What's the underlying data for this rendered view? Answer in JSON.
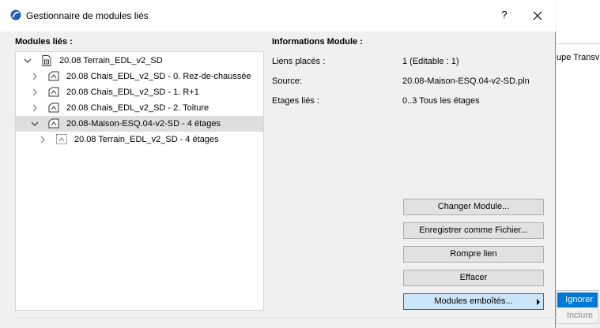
{
  "window": {
    "title": "Gestionnaire de modules liés",
    "help_label": "?"
  },
  "left_label": "Modules liés :",
  "right_label": "Informations Module :",
  "tree": [
    {
      "label": "20.08 Terrain_EDL_v2_SD",
      "level": 0,
      "expanded": true,
      "selected": false,
      "icon": "module-file-icon"
    },
    {
      "label": "20.08 Chais_EDL_v2_SD - 0. Rez-de-chaussée",
      "level": 1,
      "expanded": false,
      "selected": false,
      "icon": "linked-module-icon"
    },
    {
      "label": "20.08 Chais_EDL_v2_SD - 1. R+1",
      "level": 1,
      "expanded": false,
      "selected": false,
      "icon": "linked-module-icon"
    },
    {
      "label": "20.08 Chais_EDL_v2_SD - 2. Toiture",
      "level": 1,
      "expanded": false,
      "selected": false,
      "icon": "linked-module-icon"
    },
    {
      "label": "20.08-Maison-ESQ.04-v2-SD - 4 étages",
      "level": 1,
      "expanded": true,
      "selected": true,
      "icon": "linked-module-icon"
    },
    {
      "label": "20.08 Terrain_EDL_v2_SD - 4 étages",
      "level": 2,
      "expanded": false,
      "selected": false,
      "icon": "nested-module-icon"
    }
  ],
  "info": [
    {
      "key": "Liens placés :",
      "value": "1 (Editable : 1)"
    },
    {
      "key": "Source:",
      "value": "20.08-Maison-ESQ.04-v2-SD.pln"
    },
    {
      "key": "Etages liés :",
      "value": "0..3 Tous les étages"
    }
  ],
  "buttons": {
    "change": "Changer Module...",
    "save_as_file": "Enregistrer comme Fichier...",
    "break_link": "Rompre lien",
    "delete": "Effacer",
    "nested": "Modules emboîtés..."
  },
  "submenu": {
    "ignore": "Ignorer",
    "include": "Inclure"
  },
  "background_app": {
    "text": "upe Transv"
  },
  "colors": {
    "selection": "#dedede",
    "accent": "#0078d7",
    "hover_button": "#cce4f7"
  }
}
